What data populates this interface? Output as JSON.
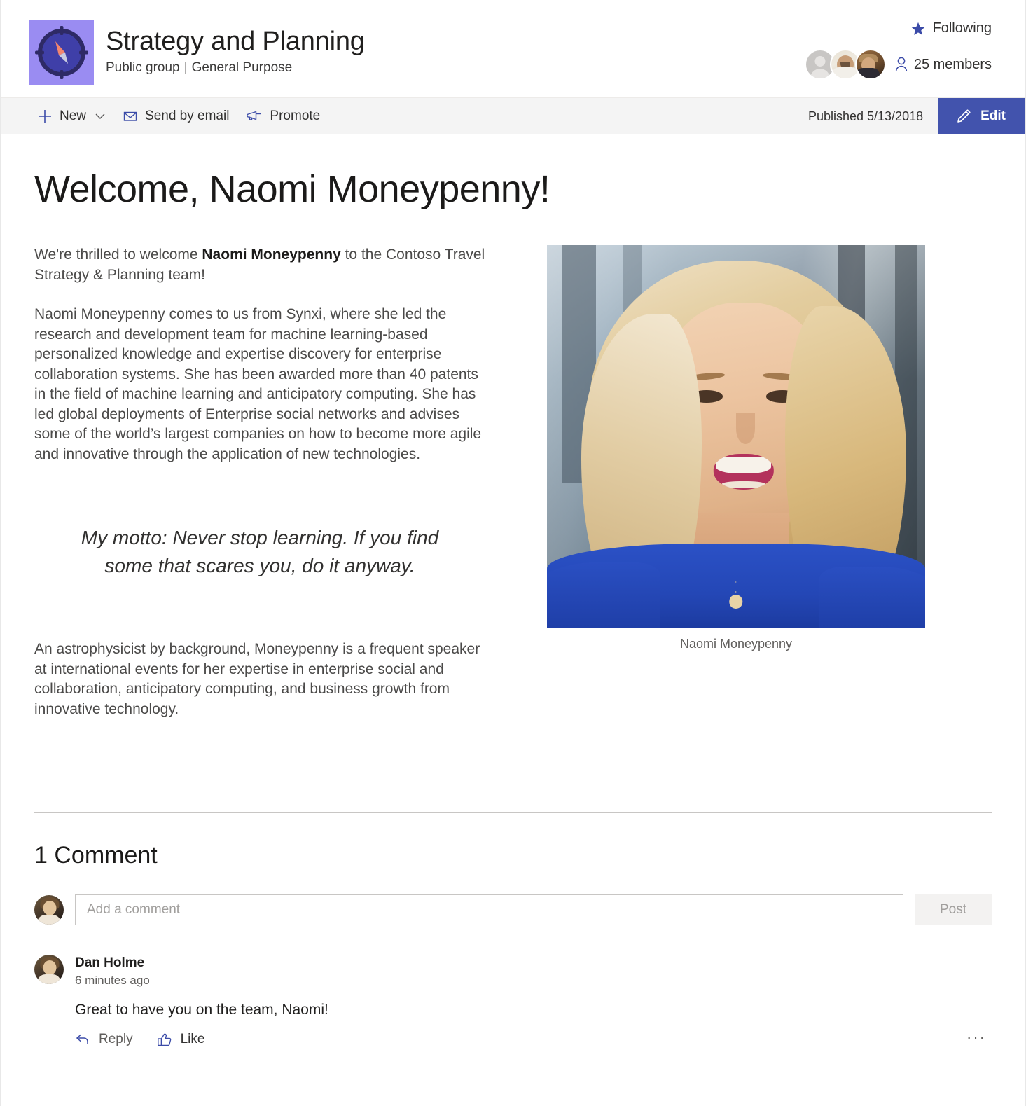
{
  "site": {
    "logo_icon": "compass-icon",
    "title": "Strategy and Planning",
    "privacy": "Public group",
    "separator": "|",
    "classification": "General Purpose",
    "following_label": "Following",
    "following_icon": "star-icon",
    "members_label": "25 members",
    "members_icon": "person-icon",
    "facepile": [
      {
        "name": "member-placeholder-avatar",
        "type": "placeholder"
      },
      {
        "name": "member-avatar-1",
        "type": "photo"
      },
      {
        "name": "member-avatar-2",
        "type": "photo"
      }
    ]
  },
  "command_bar": {
    "new_label": "New",
    "new_icon": "plus-icon",
    "new_chevron_icon": "chevron-down-icon",
    "send_by_email_label": "Send by email",
    "send_by_email_icon": "mail-icon",
    "promote_label": "Promote",
    "promote_icon": "megaphone-icon",
    "published_label": "Published 5/13/2018",
    "edit_label": "Edit",
    "edit_icon": "pencil-icon",
    "edit_button_color": "#4253ad"
  },
  "article": {
    "title": "Welcome, Naomi Moneypenny!",
    "intro_prefix": "We're thrilled to welcome ",
    "intro_bold": "Naomi Moneypenny",
    "intro_suffix": " to the Contoso Travel Strategy & Planning team!",
    "bio": "Naomi Moneypenny comes to us from Synxi, where she led the research and development team for machine learning-based personalized knowledge and expertise discovery for enterprise collaboration systems. She has been awarded more than 40 patents in the field of machine learning and anticipatory computing. She has led global deployments of Enterprise social networks and advises some of the world’s largest companies on how to become more agile and innovative through the application of new technologies.",
    "quote": "My motto: Never stop learning. If you find some that scares you, do it anyway.",
    "closing": "An astrophysicist by background, Moneypenny is a frequent speaker at international events for her expertise in enterprise social and collaboration, anticipatory computing, and business growth from innovative technology.",
    "image_caption": "Naomi Moneypenny",
    "image_alt": "portrait-of-naomi-moneypenny"
  },
  "comments": {
    "heading": "1 Comment",
    "compose_placeholder": "Add a comment",
    "compose_value": "",
    "post_label": "Post",
    "items": [
      {
        "author": "Dan Holme",
        "timestamp": "6 minutes ago",
        "text": "Great to have you on the team, Naomi!",
        "reply_label": "Reply",
        "reply_icon": "reply-arrow-icon",
        "like_label": "Like",
        "like_icon": "thumbs-up-icon",
        "more_label": "···",
        "more_icon": "more-horizontal-icon"
      }
    ]
  }
}
